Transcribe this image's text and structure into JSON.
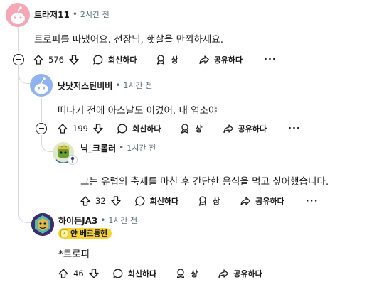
{
  "comments": [
    {
      "username": "트라저11",
      "time": "2시간 전",
      "body": "트로피를 따냈어요. 선장님, 햇살을 만끽하세요.",
      "votes": "576"
    },
    {
      "username": "낫낫저스틴비버",
      "time": "1시간 전",
      "body": "떠나기 전에 아스날도 이겼어. 내 염소야",
      "votes": "199"
    },
    {
      "username": "닉_크롤러",
      "time": "1시간 전",
      "body": "그는 유럽의 축제를 마친 후 간단한 음식을 먹고 싶어했습니다.",
      "votes": "32"
    },
    {
      "username": "하이든JA3",
      "time": "1시간 전",
      "flair": "얀 베르통헨",
      "body": "*트로피",
      "votes": "46"
    }
  ],
  "actions": {
    "reply": "회신하다",
    "award": "상",
    "share": "공유하다",
    "more": "···"
  },
  "meta": {
    "separator": "•"
  },
  "colors": {
    "text": "#1a1a1b",
    "muted": "#576f76",
    "thread": "#d6dadc",
    "flair": "#f7d433",
    "avatar_pink": "#f6a6b5",
    "avatar_blue": "#8fb3f2"
  }
}
